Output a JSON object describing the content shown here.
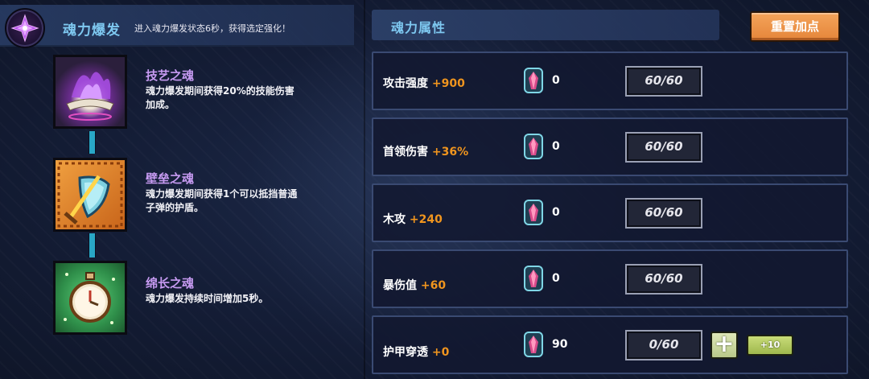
{
  "burst": {
    "title": "魂力爆发",
    "description": "进入魂力爆发状态6秒，获得选定强化！",
    "icon": "soul-burst-emblem-icon"
  },
  "talents": [
    {
      "name": "技艺之魂",
      "description_line1": "魂力爆发期间获得20%的技能伤害",
      "description_line2": "加成。",
      "icon": "purple-flame-tome-icon",
      "frame_color": "#2b1f3c"
    },
    {
      "name": "壁垒之魂",
      "description_line1": "魂力爆发期间获得1个可以抵挡普通",
      "description_line2": "子弹的护盾。",
      "icon": "shield-sword-icon",
      "frame_color": "#e07a26"
    },
    {
      "name": "绵长之魂",
      "description_line1": "魂力爆发持续时间增加5秒。",
      "description_line2": "",
      "icon": "stopwatch-icon",
      "frame_color": "#2f8f4a"
    }
  ],
  "attributes": {
    "title": "魂力属性",
    "reset_label": "重置加点",
    "rows": [
      {
        "label": "攻击强度",
        "bonus": "+900",
        "gems": "0",
        "points": "60/60"
      },
      {
        "label": "首领伤害",
        "bonus": "+36%",
        "gems": "0",
        "points": "60/60"
      },
      {
        "label": "木攻",
        "bonus": "+240",
        "gems": "0",
        "points": "60/60"
      },
      {
        "label": "暴伤值",
        "bonus": "+60",
        "gems": "0",
        "points": "60/60"
      },
      {
        "label": "护甲穿透",
        "bonus": "+0",
        "gems": "90",
        "points": "0/60",
        "plus_label": "+",
        "plus10_label": "+10"
      }
    ]
  },
  "colors": {
    "accent_title": "#7ec8f0",
    "talent_name": "#c79bf2",
    "bonus": "#f0951e",
    "reset_button": "#e5853a",
    "plus_button": "#b9c98a"
  }
}
